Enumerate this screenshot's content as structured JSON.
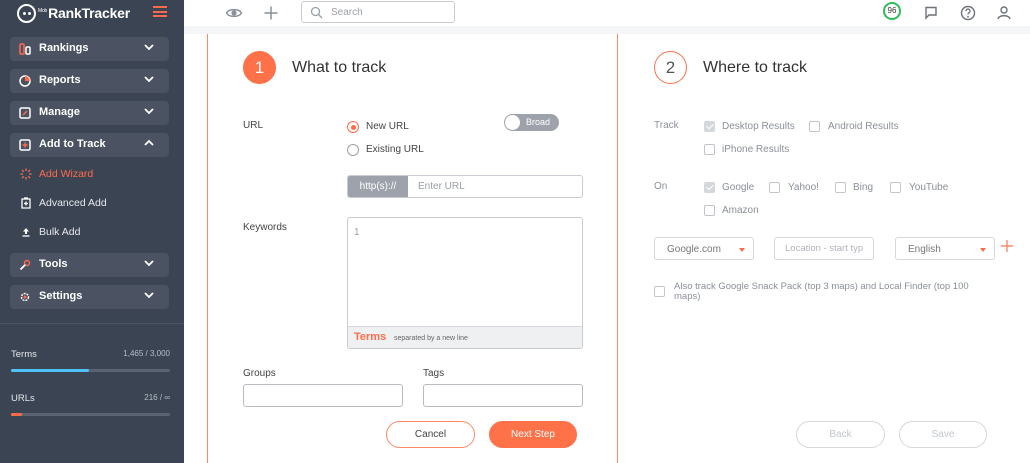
{
  "sidebar": {
    "logo": "RankTracker",
    "logo_prefix": "Mob",
    "menu": [
      {
        "label": "Rankings",
        "icon": "rankings-icon"
      },
      {
        "label": "Reports",
        "icon": "reports-icon"
      },
      {
        "label": "Manage",
        "icon": "manage-icon"
      },
      {
        "label": "Add to Track",
        "icon": "add-to-track-icon"
      }
    ],
    "sub_items": [
      {
        "label": "Add Wizard",
        "icon": "wizard-icon",
        "active": true
      },
      {
        "label": "Advanced Add",
        "icon": "advanced-add-icon"
      },
      {
        "label": "Bulk Add",
        "icon": "bulk-add-icon"
      }
    ],
    "bottom_menu": [
      {
        "label": "Tools",
        "icon": "tools-icon"
      },
      {
        "label": "Settings",
        "icon": "settings-icon"
      }
    ],
    "quotas": {
      "terms": {
        "label": "Terms",
        "value": "1,465 / 3,000",
        "fraction": 0.49,
        "color": "#4fc3f7"
      },
      "urls": {
        "label": "URLs",
        "value": "216 / ∞",
        "fraction": 0.07,
        "color": "#ff6b4a"
      }
    }
  },
  "topbar": {
    "search_placeholder": "Search",
    "score": "96"
  },
  "step1": {
    "number": "1",
    "title": "What to track",
    "url_label": "URL",
    "new_url": "New URL",
    "existing_url": "Existing URL",
    "broad_toggle": "Broad",
    "url_prefix": "http(s)://",
    "url_placeholder": "Enter URL",
    "keywords_label": "Keywords",
    "keyword_line": "1",
    "terms_label": "Terms",
    "terms_hint": "separated by a new line",
    "groups_label": "Groups",
    "tags_label": "Tags",
    "cancel": "Cancel",
    "next": "Next Step"
  },
  "step2": {
    "number": "2",
    "title": "Where to track",
    "track_label": "Track",
    "track_options": [
      {
        "label": "Desktop Results",
        "checked": true
      },
      {
        "label": "Android Results",
        "checked": false
      },
      {
        "label": "iPhone Results",
        "checked": false
      }
    ],
    "on_label": "On",
    "engines": [
      {
        "label": "Google",
        "checked": true
      },
      {
        "label": "Yahoo!",
        "checked": false
      },
      {
        "label": "Bing",
        "checked": false
      },
      {
        "label": "YouTube",
        "checked": false
      },
      {
        "label": "Amazon",
        "checked": false
      }
    ],
    "domain_select": "Google.com",
    "location_placeholder": "Location - start typ",
    "language_select": "English",
    "snack_pack": "Also track Google Snack Pack (top 3 maps) and Local Finder (top 100 maps)",
    "back": "Back",
    "save": "Save"
  },
  "colors": {
    "accent": "#ff6b4a",
    "sidebar_bg": "#3b4453",
    "nav_item_bg": "#4b5363",
    "score_ring": "#2ebd59"
  }
}
